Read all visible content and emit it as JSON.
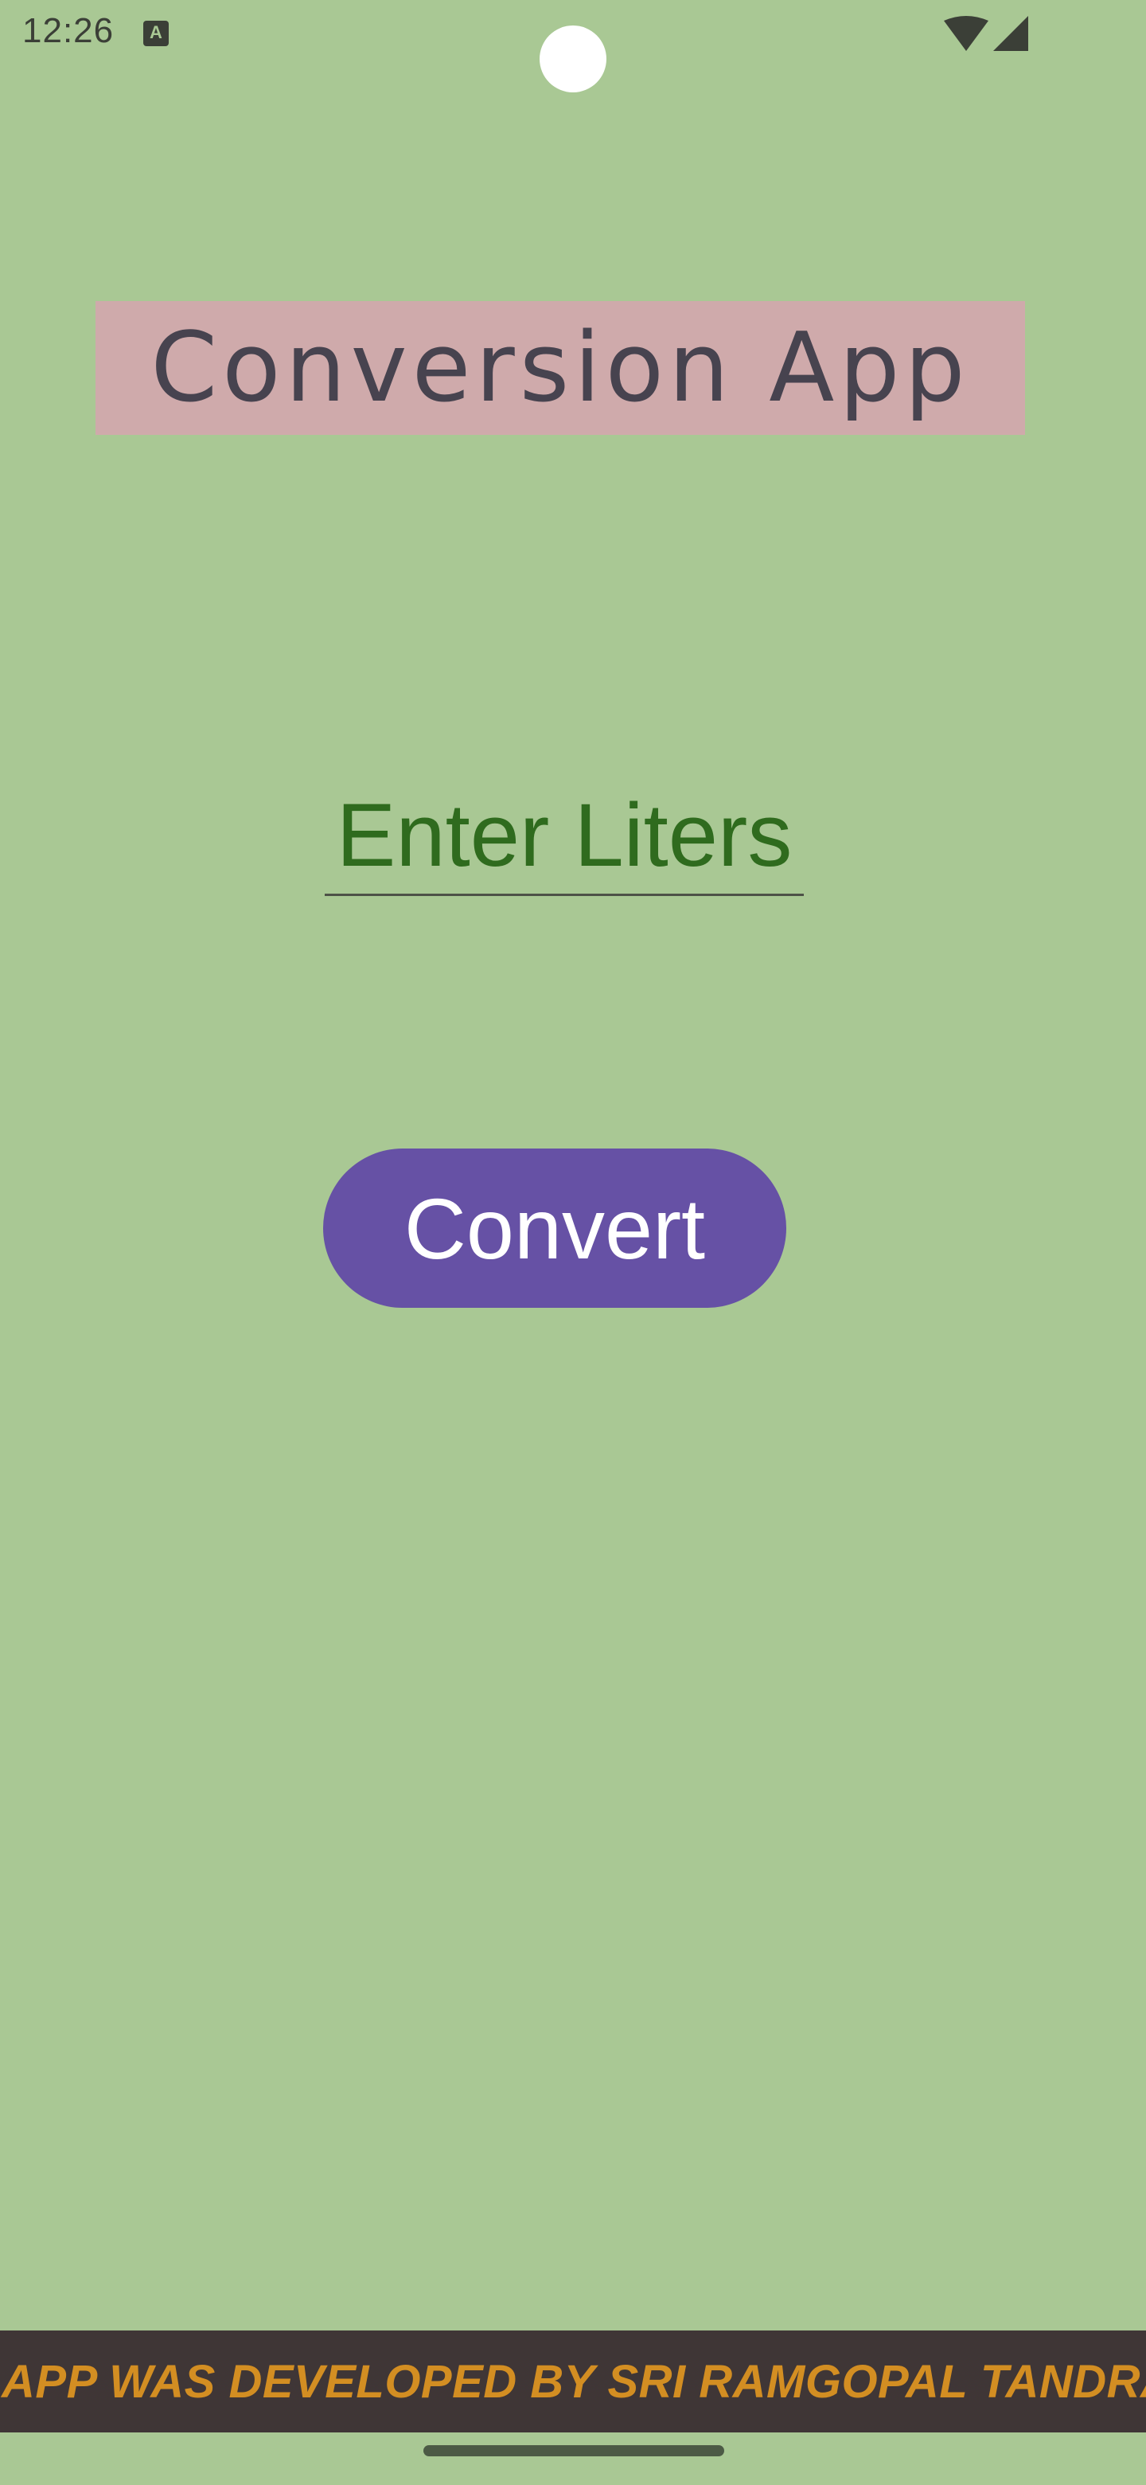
{
  "status_bar": {
    "time": "12:26",
    "notification_icon": "a-keyboard-icon",
    "wifi_icon": "wifi-icon",
    "signal_icon": "cell-signal-icon"
  },
  "app": {
    "title": "Conversion App",
    "input": {
      "value": "",
      "placeholder": "Enter Liters"
    },
    "convert_button_label": "Convert",
    "footer_text": "APP WAS DEVELOPED BY SRI RAMGOPAL TANDRA"
  },
  "colors": {
    "background": "#a9c894",
    "title_background": "#cfaaab",
    "title_text": "#47434f",
    "input_text": "#2f6b1e",
    "button": "#6651a5",
    "footer_background": "#3f3636",
    "footer_text": "#d38e22"
  }
}
